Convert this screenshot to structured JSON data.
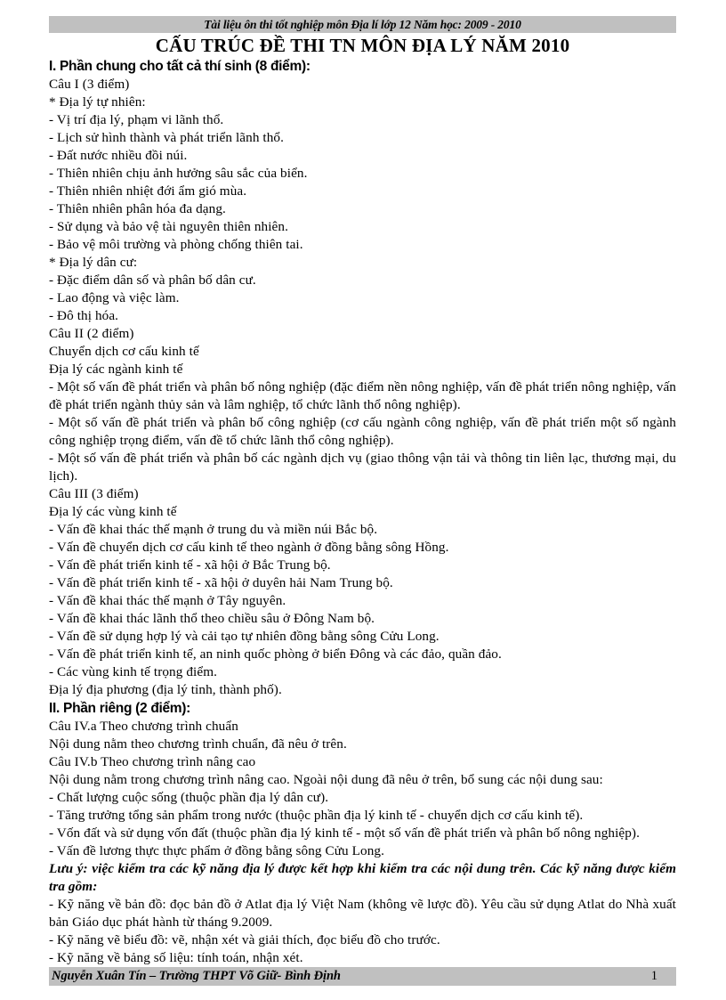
{
  "header": {
    "running_text": "Tài liệu ôn thi tốt nghiệp môn Địa lí lớp 12 Năm học: 2009 - 2010"
  },
  "document": {
    "title": "CẤU TRÚC ĐỀ THI TN MÔN ĐỊA LÝ  NĂM 2010"
  },
  "section_1": {
    "heading": "I. Phần chung cho tất cả thí sinh (8 điểm):",
    "cau_1": {
      "label": "Câu I (3 điểm)",
      "sub_1_label": "* Địa lý tự nhiên:",
      "sub_1_items": [
        "- Vị trí địa lý, phạm vi lãnh thổ.",
        "- Lịch sử hình thành và phát triển lãnh thổ.",
        "- Đất nước nhiều đồi núi.",
        "- Thiên nhiên chịu ảnh hưởng sâu sắc của biển.",
        "- Thiên nhiên nhiệt đới ẩm gió mùa.",
        "- Thiên nhiên phân hóa đa dạng.",
        "- Sử dụng và bảo vệ tài nguyên thiên nhiên.",
        "- Bảo vệ môi trường và phòng chống thiên tai."
      ],
      "sub_2_label": "* Địa lý dân cư:",
      "sub_2_items": [
        "- Đặc điểm dân số và phân bố dân cư.",
        "- Lao động và việc làm.",
        "- Đô thị hóa."
      ]
    },
    "cau_2": {
      "label": "Câu II (2 điểm)",
      "intro_1": "Chuyển dịch cơ cấu kinh tế",
      "intro_2": "Địa lý các ngành kinh tế",
      "items": [
        "- Một số vấn đề phát triển và phân bố nông nghiệp (đặc điểm nền nông nghiệp, vấn đề phát triển nông nghiệp, vấn đề phát triển ngành thủy sản và lâm nghiệp, tổ chức lãnh thổ nông nghiệp).",
        "- Một số vấn đề phát triển và phân bố công nghiệp (cơ cấu ngành công nghiệp, vấn đề phát triển một số ngành công nghiệp trọng điểm, vấn đề tổ chức lãnh thổ công nghiệp).",
        "- Một số vấn đề phát triển và phân bố các ngành dịch vụ (giao thông vận tải và thông tin liên lạc, thương mại, du lịch)."
      ]
    },
    "cau_3": {
      "label": "Câu III (3 điểm)",
      "intro": "Địa lý các vùng kinh tế",
      "items": [
        "- Vấn đề khai thác thế mạnh ở trung du và miền núi Bắc bộ.",
        "- Vấn đề chuyển dịch cơ cấu kinh tế theo ngành ở đồng bằng sông Hồng.",
        "- Vấn đề phát triển kinh tế - xã hội ở Bắc Trung bộ.",
        "- Vấn đề phát triển kinh tế - xã hội ở duyên hải Nam Trung bộ.",
        "- Vấn đề khai thác thế mạnh ở Tây nguyên.",
        "- Vấn đề khai thác lãnh thổ theo chiều sâu ở Đông Nam bộ.",
        "- Vấn đề sử dụng hợp lý và cải tạo tự nhiên đồng bằng sông Cửu Long.",
        "- Vấn đề phát triển kinh tế, an ninh quốc phòng ở biển Đông và các đảo, quần đảo.",
        "- Các vùng kinh tế trọng điểm."
      ],
      "closing": "Địa lý địa phương (địa lý tỉnh, thành phố)."
    }
  },
  "section_2": {
    "heading": "II. Phần riêng (2 điểm):",
    "cau_4a": {
      "label": "Câu IV.a Theo chương trình chuẩn",
      "body": "Nội dung nằm theo chương trình chuẩn, đã nêu ở trên."
    },
    "cau_4b": {
      "label": "Câu IV.b Theo chương trình nâng cao",
      "body": "Nội dung nằm trong chương trình nâng cao. Ngoài nội dung đã nêu ở trên, bổ sung các nội dung sau:",
      "items": [
        "- Chất lượng cuộc sống (thuộc phần địa lý dân cư).",
        "- Tăng trưởng tổng sản phẩm trong nước (thuộc phần địa lý kinh tế - chuyển dịch cơ cấu kinh tế).",
        "- Vốn đất và sử dụng vốn đất (thuộc phần địa lý kinh tế - một số vấn đề phát triển và phân bố nông nghiệp).",
        "- Vấn đề lương thực thực phẩm ở đồng bằng sông Cửu Long."
      ]
    },
    "note": {
      "text": "Lưu ý: việc kiểm tra các kỹ năng địa lý được kết hợp khi kiểm tra các nội dung trên. Các kỹ năng được kiểm tra gồm:",
      "items": [
        "- Kỹ năng về bản đồ: đọc bản đồ ở Atlat địa lý Việt Nam (không vẽ lược đồ). Yêu cầu sử dụng Atlat do Nhà xuất bản Giáo dục phát hành từ tháng 9.2009.",
        "- Kỹ năng vẽ biểu đồ: vẽ, nhận xét và giải thích, đọc biểu đồ cho trước.",
        "- Kỹ năng về bảng số liệu: tính toán, nhận xét."
      ]
    }
  },
  "footer": {
    "author_line": "Nguyễn Xuân Tín – Trường THPT Võ Giữ- Bình Định",
    "page_number": "1"
  }
}
